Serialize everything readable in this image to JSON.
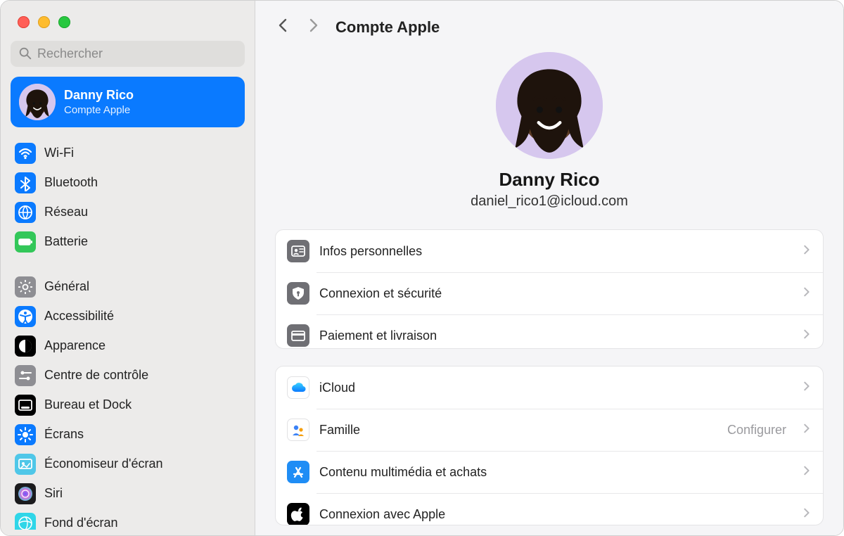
{
  "header": {
    "title": "Compte Apple"
  },
  "search": {
    "placeholder": "Rechercher"
  },
  "profile": {
    "name": "Danny Rico",
    "subtitle": "Compte Apple",
    "display_name": "Danny Rico",
    "email": "daniel_rico1@icloud.com"
  },
  "sidebar": {
    "group1": [
      {
        "key": "wifi",
        "label": "Wi-Fi",
        "icon": "wifi",
        "bg": "#0a7aff"
      },
      {
        "key": "bluetooth",
        "label": "Bluetooth",
        "icon": "bluetooth",
        "bg": "#0a7aff"
      },
      {
        "key": "network",
        "label": "Réseau",
        "icon": "network",
        "bg": "#0a7aff"
      },
      {
        "key": "battery",
        "label": "Batterie",
        "icon": "battery",
        "bg": "#33c759"
      }
    ],
    "group2": [
      {
        "key": "general",
        "label": "Général",
        "icon": "gear",
        "bg": "#8e8e93"
      },
      {
        "key": "accessibility",
        "label": "Accessibilité",
        "icon": "accessibility",
        "bg": "#0a7aff"
      },
      {
        "key": "appearance",
        "label": "Apparence",
        "icon": "appearance",
        "bg": "#000000"
      },
      {
        "key": "controlcenter",
        "label": "Centre de contrôle",
        "icon": "switches",
        "bg": "#8e8e93"
      },
      {
        "key": "dock",
        "label": "Bureau et Dock",
        "icon": "dock",
        "bg": "#000000"
      },
      {
        "key": "displays",
        "label": "Écrans",
        "icon": "sun",
        "bg": "#0a7aff"
      },
      {
        "key": "screensaver",
        "label": "Économiseur d'écran",
        "icon": "screensaver",
        "bg": "#4fc7e8"
      },
      {
        "key": "siri",
        "label": "Siri",
        "icon": "siri",
        "bg": "#1b1b1d"
      },
      {
        "key": "wallpaper",
        "label": "Fond d'écran",
        "icon": "wallpaper",
        "bg": "#2fd6e8"
      }
    ]
  },
  "sections": {
    "account": [
      {
        "key": "personal",
        "label": "Infos personnelles",
        "icon": "idcard",
        "bg": "#6f6f74"
      },
      {
        "key": "security",
        "label": "Connexion et sécurité",
        "icon": "shield",
        "bg": "#6f6f74"
      },
      {
        "key": "payment",
        "label": "Paiement et livraison",
        "icon": "card",
        "bg": "#6f6f74"
      }
    ],
    "services": [
      {
        "key": "icloud",
        "label": "iCloud",
        "icon": "cloud",
        "bg": "#ffffff"
      },
      {
        "key": "family",
        "label": "Famille",
        "icon": "family",
        "bg": "#ffffff",
        "trail": "Configurer"
      },
      {
        "key": "media",
        "label": "Contenu multimédia et achats",
        "icon": "appstore",
        "bg": "#1f8df5"
      },
      {
        "key": "signin",
        "label": "Connexion avec Apple",
        "icon": "apple",
        "bg": "#000000"
      }
    ]
  }
}
